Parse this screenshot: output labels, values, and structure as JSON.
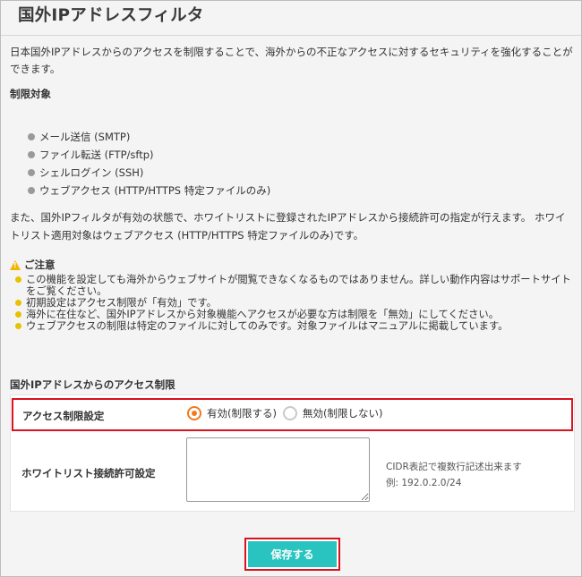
{
  "page": {
    "title": "国外IPアドレスフィルタ",
    "intro": "日本国外IPアドレスからのアクセスを制限することで、海外からの不正なアクセスに対するセキュリティを強化することができます。",
    "targets_label": "制限対象",
    "targets": [
      "メール送信 (SMTP)",
      "ファイル転送 (FTP/sftp)",
      "シェルログイン (SSH)",
      "ウェブアクセス (HTTP/HTTPS 特定ファイルのみ)"
    ],
    "whitelist_note": "また、国外IPフィルタが有効の状態で、ホワイトリストに登録されたIPアドレスから接続許可の指定が行えます。 ホワイトリスト適用対象はウェブアクセス (HTTP/HTTPS 特定ファイルのみ)です。",
    "caution_title": "ご注意",
    "cautions": [
      "この機能を設定しても海外からウェブサイトが閲覧できなくなるものではありません。詳しい動作内容はサポートサイトをご覧ください。",
      "初期設定はアクセス制限が「有効」です。",
      "海外に在住など、国外IPアドレスから対象機能へアクセスが必要な方は制限を「無効」にしてください。",
      "ウェブアクセスの制限は特定のファイルに対してのみです。対象ファイルはマニュアルに掲載しています。"
    ]
  },
  "form": {
    "section_title": "国外IPアドレスからのアクセス制限",
    "access_label": "アクセス制限設定",
    "option_enabled": "有効(制限する)",
    "option_disabled": "無効(制限しない)",
    "selected": "有効(制限する)",
    "whitelist_label": "ホワイトリスト接続許可設定",
    "whitelist_value": "",
    "hint_line1": "CIDR表記で複数行記述出来ます",
    "hint_line2": "例: 192.0.2.0/24",
    "save_label": "保存する"
  },
  "colors": {
    "accent_orange": "#f07a1f",
    "save_button": "#29c4bf",
    "highlight_red": "#d9121e",
    "caution_yellow": "#e6c200"
  }
}
